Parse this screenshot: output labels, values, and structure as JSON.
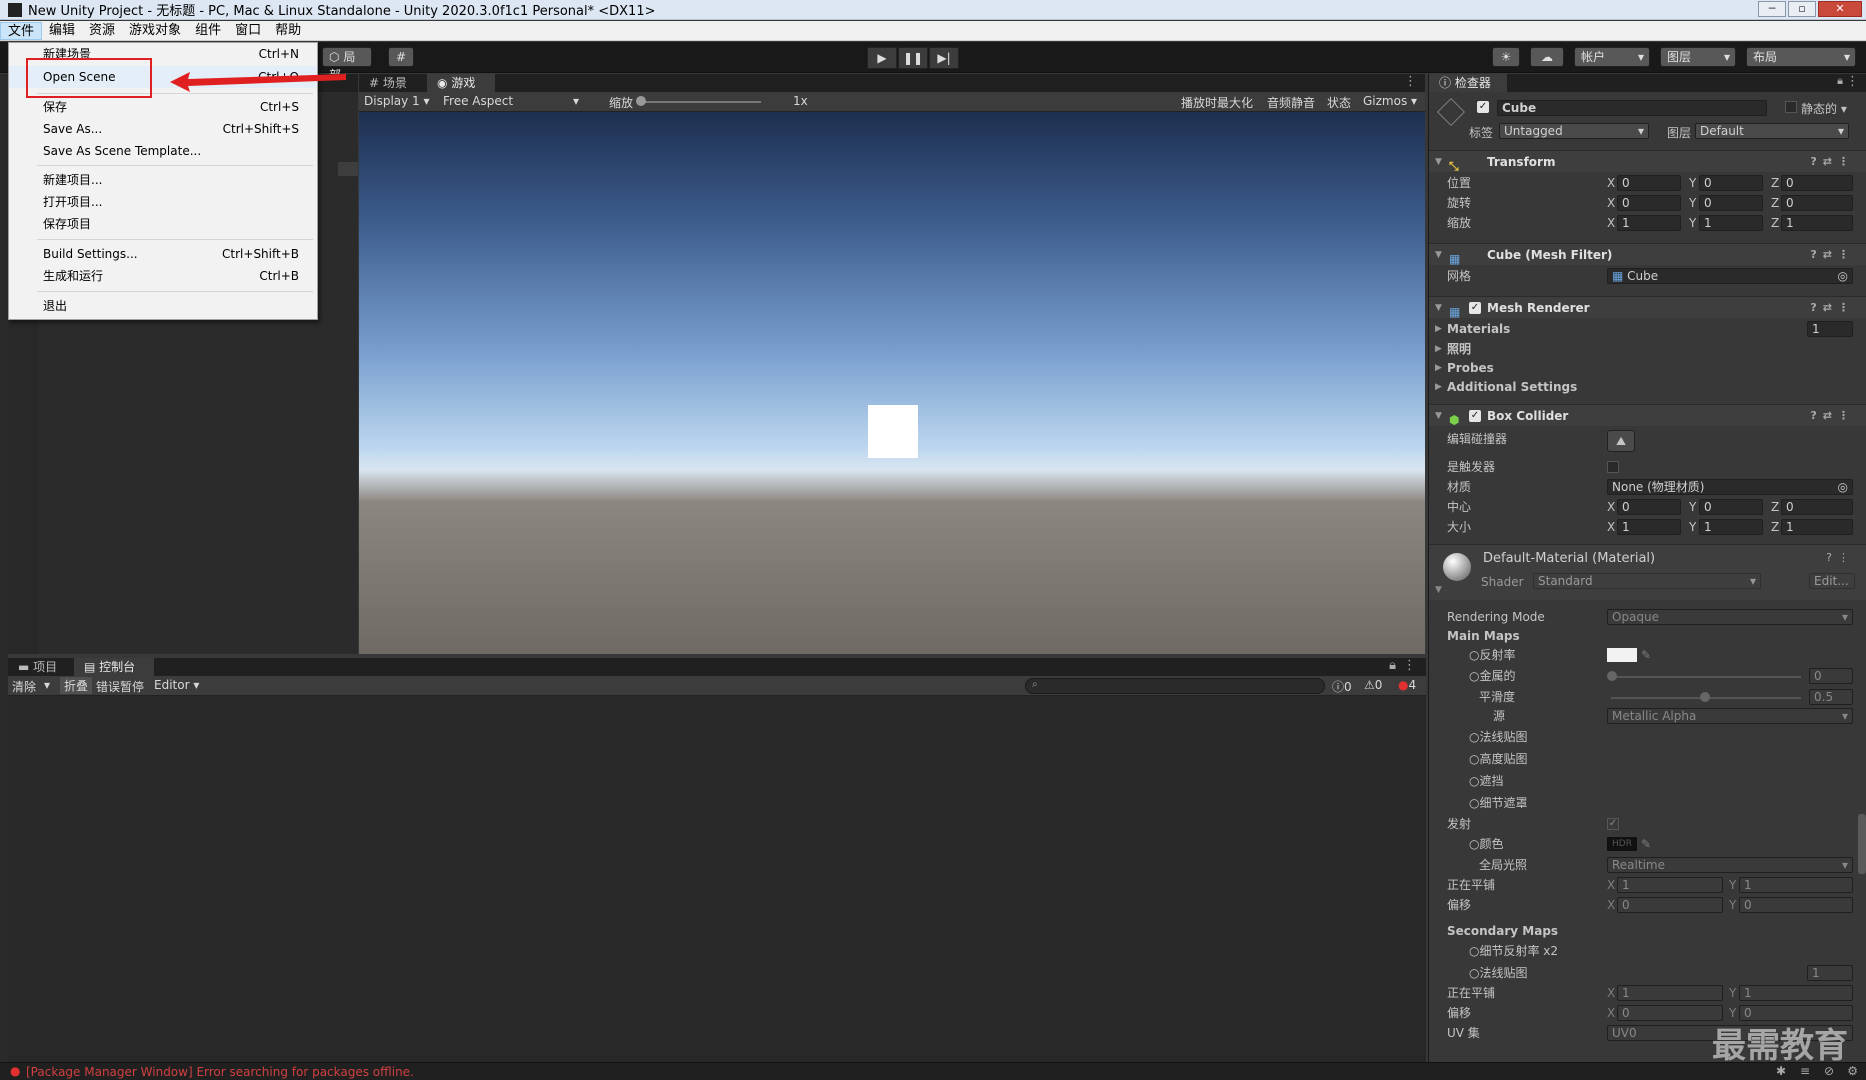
{
  "window": {
    "title": "New Unity Project - 无标题 - PC, Mac & Linux Standalone - Unity 2020.3.0f1c1 Personal* <DX11>"
  },
  "menubar": {
    "items": [
      "文件",
      "编辑",
      "资源",
      "游戏对象",
      "组件",
      "窗口",
      "帮助"
    ]
  },
  "file_menu": {
    "items": [
      {
        "label": "新建场景",
        "shortcut": "Ctrl+N"
      },
      {
        "label": "Open Scene",
        "shortcut": "Ctrl+O"
      },
      {
        "label": "保存",
        "shortcut": "Ctrl+S"
      },
      {
        "label": "Save As...",
        "shortcut": "Ctrl+Shift+S"
      },
      {
        "label": "Save As Scene Template...",
        "shortcut": ""
      },
      {
        "label": "新建项目...",
        "shortcut": ""
      },
      {
        "label": "打开项目...",
        "shortcut": ""
      },
      {
        "label": "保存项目",
        "shortcut": ""
      },
      {
        "label": "Build Settings...",
        "shortcut": "Ctrl+Shift+B"
      },
      {
        "label": "生成和运行",
        "shortcut": "Ctrl+B"
      },
      {
        "label": "退出",
        "shortcut": ""
      }
    ]
  },
  "toolbar": {
    "local": "局部",
    "account": "帐户",
    "layers": "图层",
    "layout": "布局"
  },
  "game_tabs": {
    "scene": "场景",
    "game": "游戏"
  },
  "game_bar": {
    "display": "Display 1",
    "aspect": "Free Aspect",
    "scale_label": "缩放",
    "scale_value": "1x",
    "maximize": "播放时最大化",
    "mute": "音频静音",
    "stats": "状态",
    "gizmos": "Gizmos"
  },
  "bottom_tabs": {
    "project": "项目",
    "console": "控制台"
  },
  "console_bar": {
    "clear": "清除",
    "collapse": "折叠",
    "error_pause": "错误暂停",
    "editor": "Editor",
    "count_log": "0",
    "count_warn": "0",
    "count_err": "4"
  },
  "status": {
    "message": "[Package Manager Window] Error searching for packages offline."
  },
  "inspector": {
    "tab": "检查器",
    "object_name": "Cube",
    "static_label": "静态的",
    "tag_label": "标签",
    "tag_value": "Untagged",
    "layer_label": "图层",
    "layer_value": "Default",
    "transform": {
      "title": "Transform",
      "position": "位置",
      "rotation": "旋转",
      "scale": "缩放",
      "pos": [
        "0",
        "0",
        "0"
      ],
      "rot": [
        "0",
        "0",
        "0"
      ],
      "scl": [
        "1",
        "1",
        "1"
      ]
    },
    "mesh_filter": {
      "title": "Cube (Mesh Filter)",
      "mesh_label": "网格",
      "mesh_value": "Cube"
    },
    "mesh_renderer": {
      "title": "Mesh Renderer",
      "materials": "Materials",
      "materials_count": "1",
      "lighting": "照明",
      "probes": "Probes",
      "additional": "Additional Settings"
    },
    "box_collider": {
      "title": "Box Collider",
      "edit_label": "编辑碰撞器",
      "trigger_label": "是触发器",
      "material_label": "材质",
      "material_value": "None (物理材质)",
      "center_label": "中心",
      "size_label": "大小",
      "center": [
        "0",
        "0",
        "0"
      ],
      "size": [
        "1",
        "1",
        "1"
      ]
    },
    "material": {
      "title": "Default-Material (Material)",
      "shader_label": "Shader",
      "shader_value": "Standard",
      "edit": "Edit...",
      "rendering_mode_label": "Rendering Mode",
      "rendering_mode_value": "Opaque",
      "main_maps": "Main Maps",
      "albedo": "反射率",
      "metallic": "金属的",
      "metallic_value": "0",
      "smoothness": "平滑度",
      "smoothness_value": "0.5",
      "source": "源",
      "source_value": "Metallic Alpha",
      "normal": "法线贴图",
      "height": "高度贴图",
      "occlusion": "遮挡",
      "detail_mask": "细节遮罩",
      "emission": "发射",
      "color": "颜色",
      "hdr": "HDR",
      "gi": "全局光照",
      "gi_value": "Realtime",
      "tiling": "正在平铺",
      "offset": "偏移",
      "tiling_vals": [
        "1",
        "1"
      ],
      "offset_vals": [
        "0",
        "0"
      ],
      "secondary_maps": "Secondary Maps",
      "detail_albedo": "细节反射率 x2",
      "sec_normal": "法线贴图",
      "sec_normal_value": "1",
      "sec_tiling": "正在平铺",
      "sec_offset": "偏移",
      "sec_tiling_vals": [
        "1",
        "1"
      ],
      "sec_offset_vals": [
        "0",
        "0"
      ],
      "uv_label": "UV 集",
      "uv_value": "UV0"
    }
  },
  "watermark": "最需教育"
}
